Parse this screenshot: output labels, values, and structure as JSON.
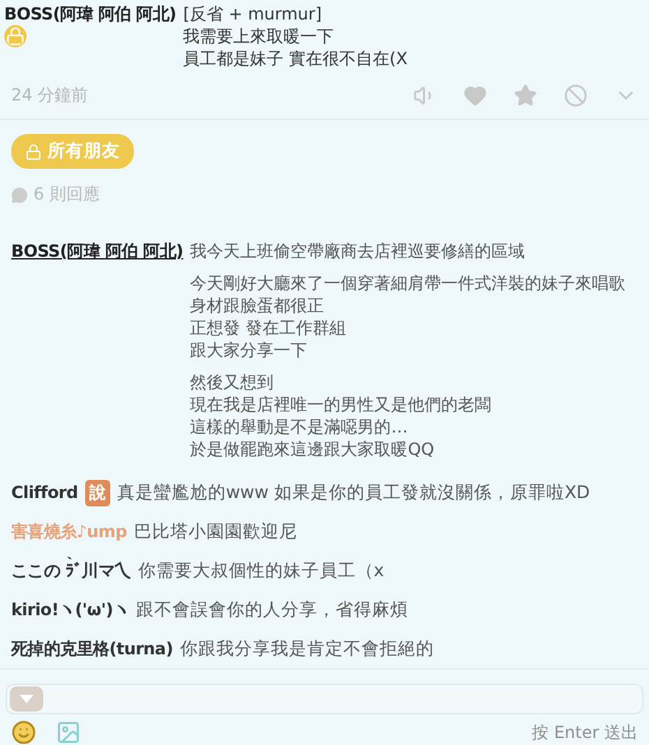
{
  "post": {
    "author": "BOSS(阿瑋 阿伯 阿北)",
    "tag": "[反省 + murmur]",
    "lines": [
      "我需要上來取暖一下",
      "員工都是妹子 實在很不自在(X"
    ],
    "time": "24 分鐘前"
  },
  "audience": {
    "label": "所有朋友"
  },
  "reply_count": "6 則回應",
  "thread": {
    "author": "BOSS(阿瑋 阿伯 阿北)",
    "paragraphs": [
      [
        "我今天上班偷空帶廠商去店裡巡要修繕的區域"
      ],
      [
        "今天剛好大廳來了一個穿著細肩帶一件式洋裝的妹子來唱歌",
        "身材跟臉蛋都很正",
        "正想發 發在工作群組",
        "跟大家分享一下"
      ],
      [
        "然後又想到",
        "現在我是店裡唯一的男性又是他們的老闆",
        "這樣的舉動是不是滿噁男的…",
        "於是做罷跑來這邊跟大家取暖QQ"
      ]
    ]
  },
  "comments": [
    {
      "name": "Clifford",
      "color": "#333333",
      "badge": "說",
      "text": "真是蠻尷尬的www 如果是你的員工發就沒關係，原罪啦XD"
    },
    {
      "name": "害喜燒糸♪ump",
      "color": "#e8a27a",
      "text": "巴比塔小園園歡迎尼"
    },
    {
      "name": "ここの ﾗ̀ﾞ川マ乀",
      "color": "#333333",
      "text": "你需要大叔個性的妹子員工（x"
    },
    {
      "name": "kirio!ヽ('ω')ヽ",
      "color": "#333333",
      "text": "跟不會誤會你的人分享，省得麻煩"
    },
    {
      "name": "死掉的克里格(turna)",
      "color": "#333333",
      "text": "你跟我分享我是肯定不會拒絕的"
    }
  ],
  "composer": {
    "hint": "按 Enter 送出"
  }
}
